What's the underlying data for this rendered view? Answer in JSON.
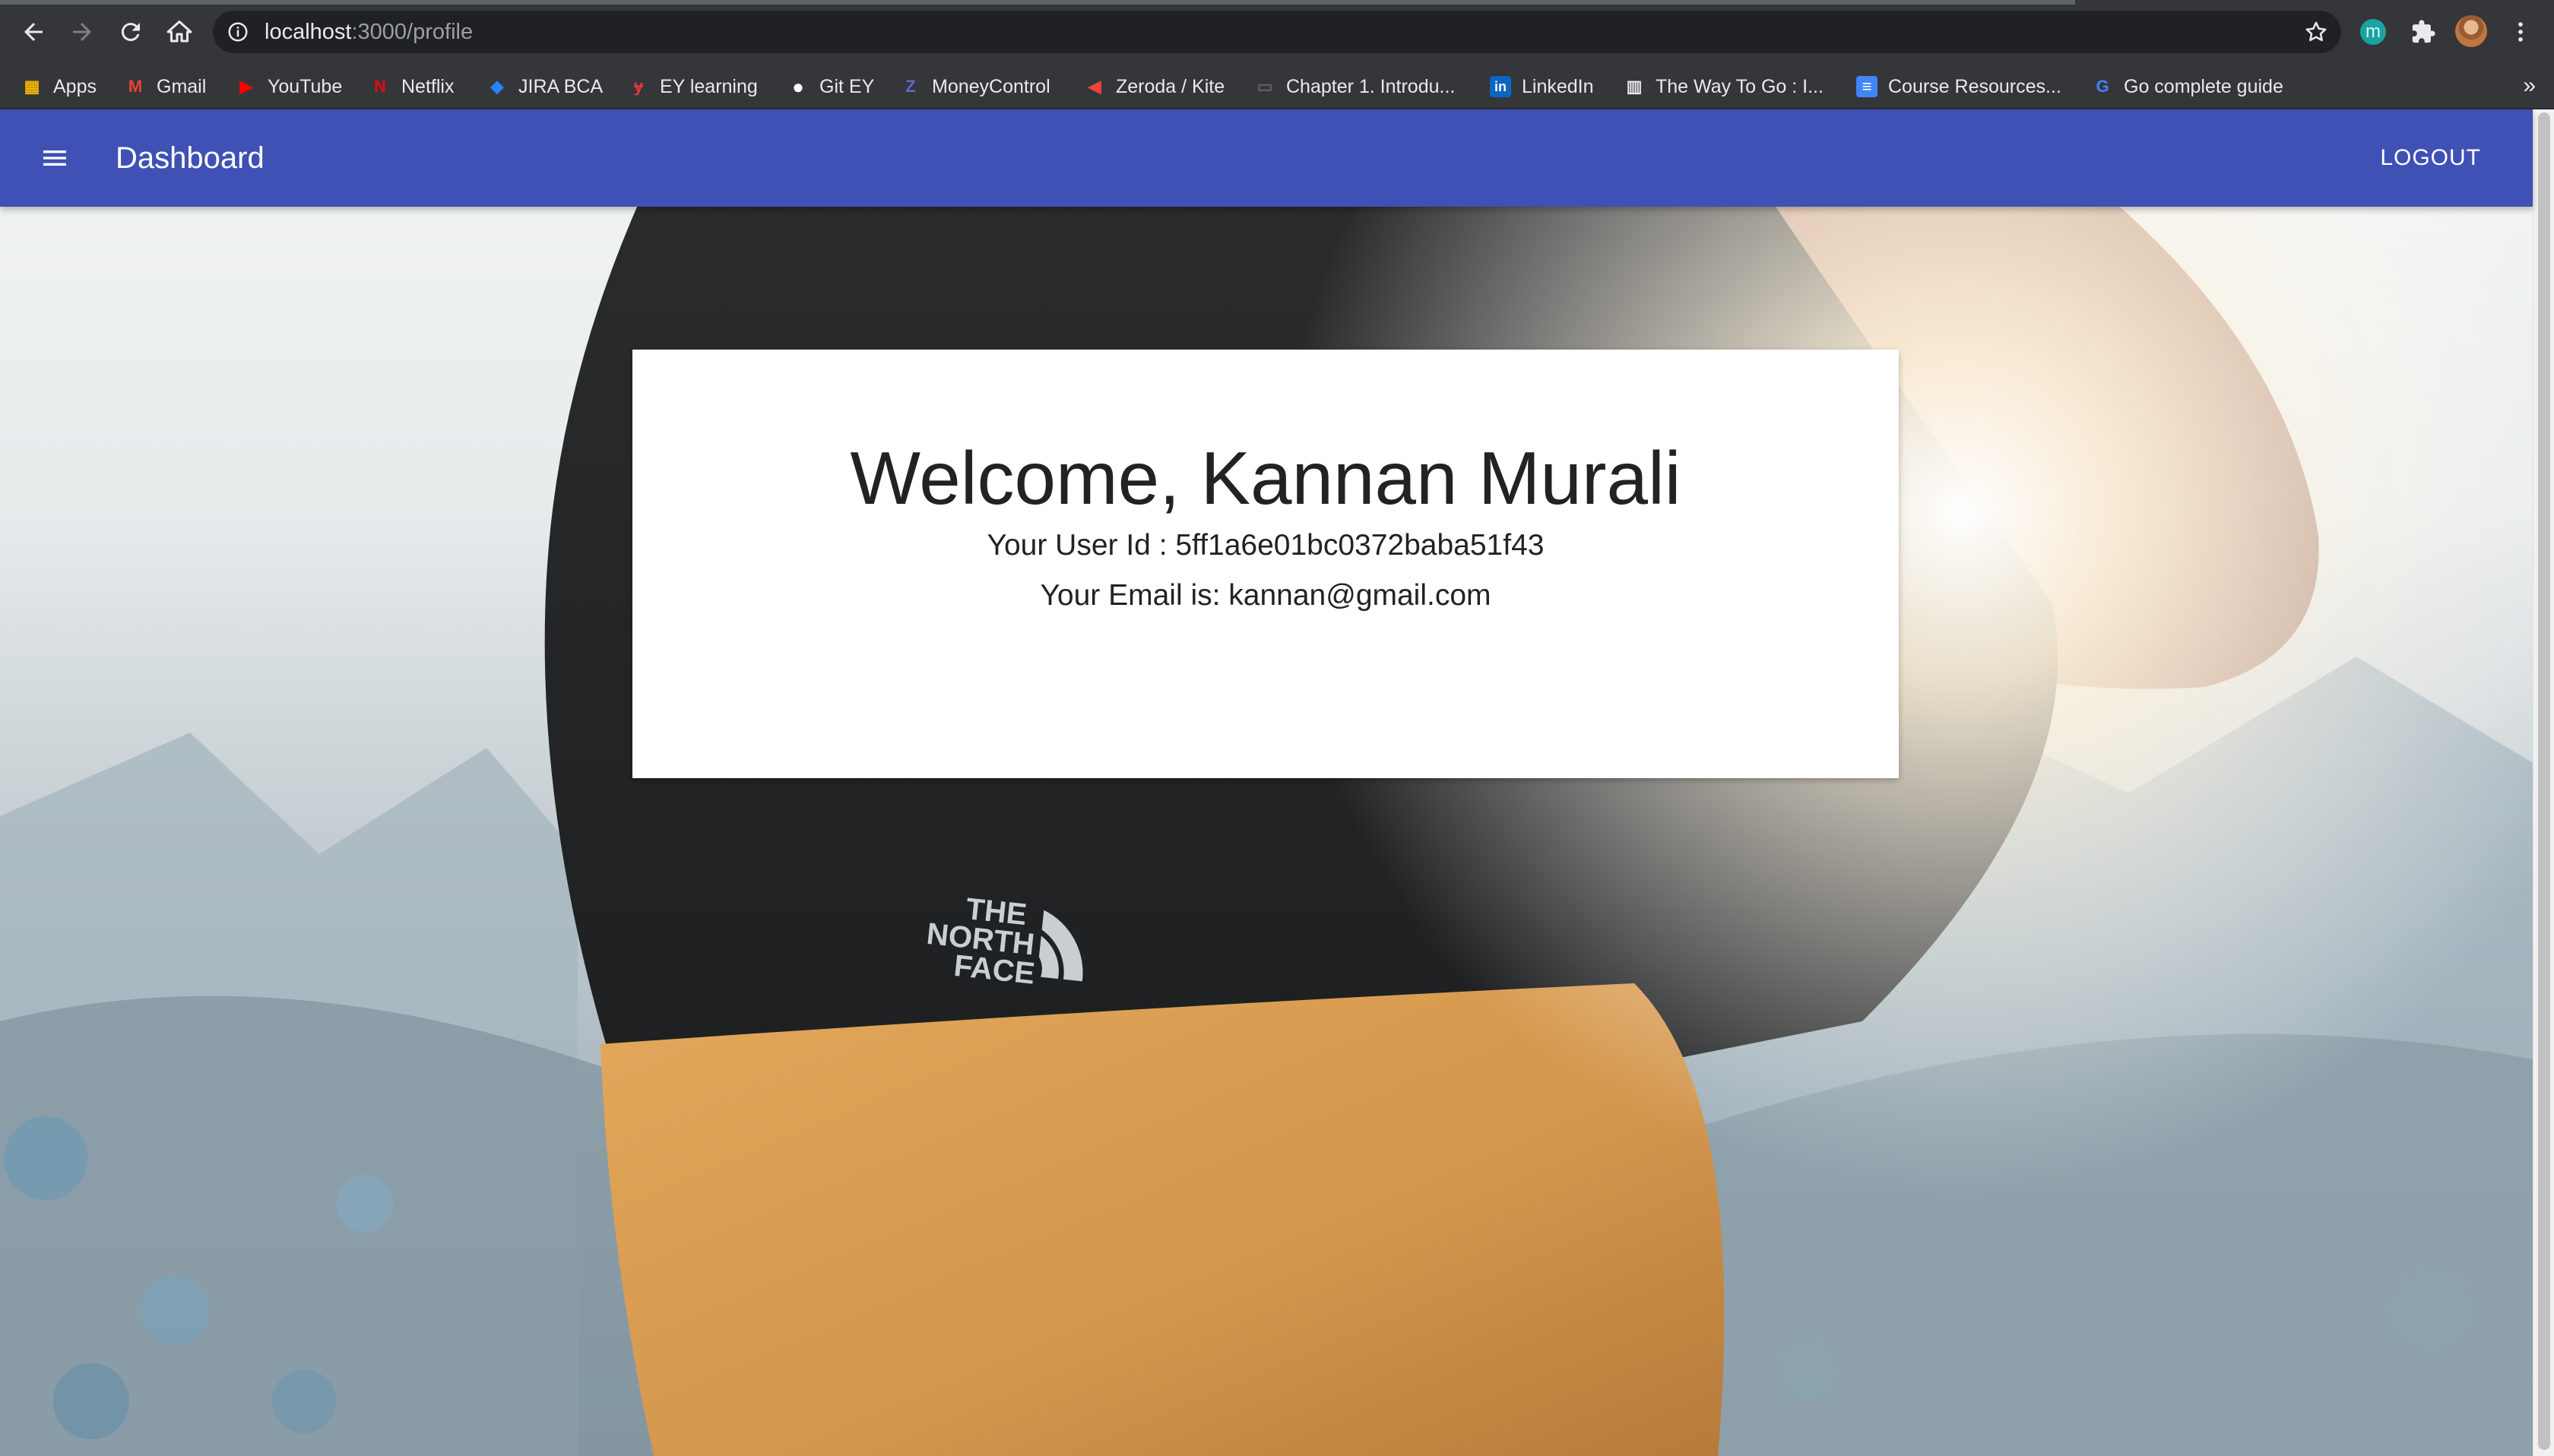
{
  "browser": {
    "url_host": "localhost",
    "url_path": ":3000/profile",
    "bookmarks": [
      {
        "label": "Apps",
        "icon": "apps-grid-icon",
        "color": "#f4b400"
      },
      {
        "label": "Gmail",
        "icon": "gmail-icon",
        "color": "#ea4335"
      },
      {
        "label": "YouTube",
        "icon": "youtube-icon",
        "color": "#ff0000"
      },
      {
        "label": "Netflix",
        "icon": "netflix-icon",
        "color": "#e50914"
      },
      {
        "label": "JIRA BCA",
        "icon": "jira-icon",
        "color": "#2684ff"
      },
      {
        "label": "EY learning",
        "icon": "ey-learning-icon",
        "color": "#e53935"
      },
      {
        "label": "Git EY",
        "icon": "github-icon",
        "color": "#ffffff"
      },
      {
        "label": "MoneyControl",
        "icon": "moneycontrol-icon",
        "color": "#5c6bc0"
      },
      {
        "label": "Zeroda / Kite",
        "icon": "kite-icon",
        "color": "#f44336"
      },
      {
        "label": "Chapter 1. Introdu...",
        "icon": "book-icon",
        "color": "#5f6368"
      },
      {
        "label": "LinkedIn",
        "icon": "linkedin-icon",
        "color": "#0a66c2"
      },
      {
        "label": "The Way To Go : I...",
        "icon": "building-icon",
        "color": "#e8eaed"
      },
      {
        "label": "Course Resources...",
        "icon": "docs-icon",
        "color": "#4285f4"
      },
      {
        "label": "Go complete guide",
        "icon": "google-icon",
        "color": "#4285f4"
      }
    ],
    "more": "»",
    "extension_letter": "m"
  },
  "app": {
    "title": "Dashboard",
    "logout_label": "LOGOUT",
    "primary_color": "#3f51b5"
  },
  "profile": {
    "welcome": "Welcome, Kannan Murali",
    "user_id_line": "Your User Id : 5ff1a6e01bc0372baba51f43",
    "email_line": "Your Email is: kannan@gmail.com"
  },
  "background": {
    "logo_line1": "THE",
    "logo_line2": "NORTH",
    "logo_line3": "FACE"
  }
}
